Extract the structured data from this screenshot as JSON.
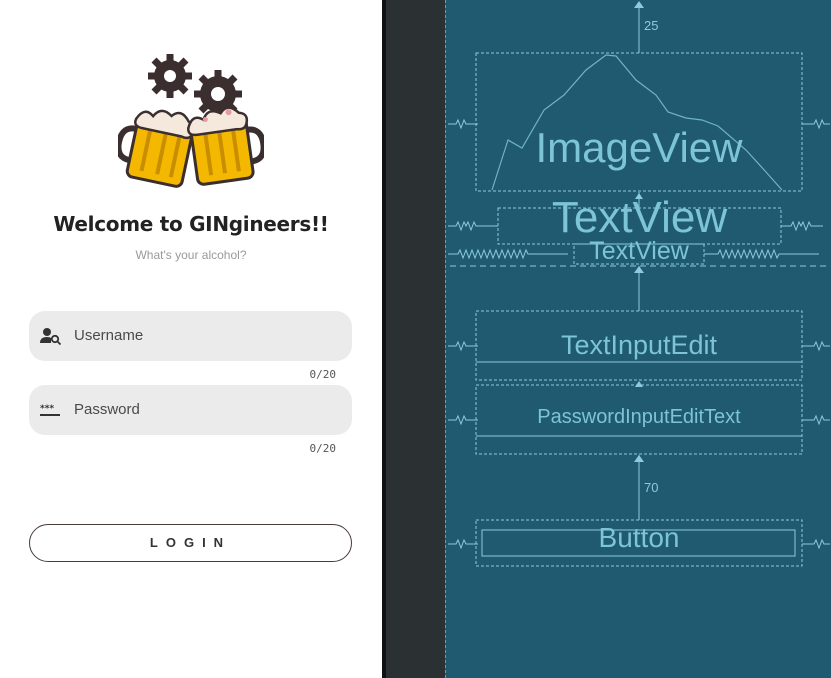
{
  "preview": {
    "title": "Welcome to GINgineers!!",
    "subtitle": "What's your alcohol?",
    "username": {
      "placeholder": "Username",
      "counter": "0/20",
      "icon": "person-search-icon"
    },
    "password": {
      "placeholder": "Password",
      "counter": "0/20",
      "icon": "password-dots-icon"
    },
    "login_label": "LOGIN",
    "logo_icon": "beer-mugs-gears-logo"
  },
  "blueprint": {
    "imageview": "ImageView",
    "textview_1": "TextView",
    "textview_2": "TextView",
    "textinput": "TextInputEdit",
    "passwordinput": "PasswordInputEditText",
    "button": "Button",
    "margin_top": "25",
    "margin_button": "70"
  },
  "colors": {
    "blueprint_bg": "#1f5a70",
    "blueprint_line": "#7cc4d6",
    "mug_beer": "#f5b800",
    "login_border": "#4a3a3a"
  }
}
